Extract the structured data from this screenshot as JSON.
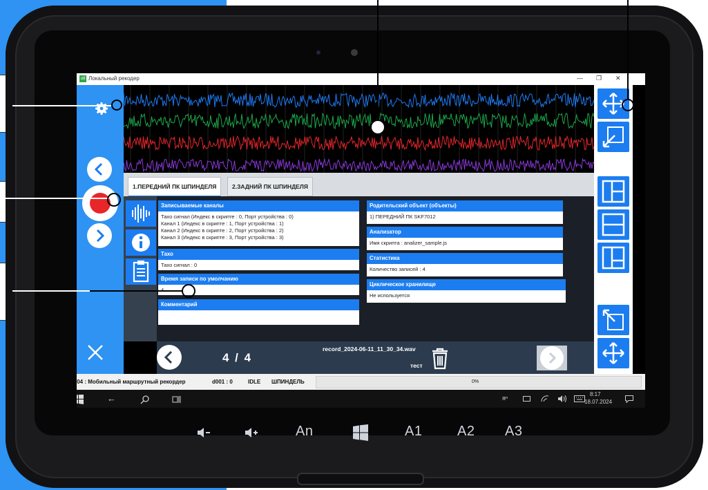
{
  "window": {
    "title": "Локальный рекодер",
    "logo_text": "u8",
    "controls": [
      "—",
      "❐",
      "✕"
    ]
  },
  "tabs": [
    {
      "label": "1.ПЕРЕДНИЙ ПК ШПИНДЕЛЯ",
      "active": true
    },
    {
      "label": "2.ЗАДНИЙ ПК ШПИНДЕЛЯ",
      "active": false
    }
  ],
  "waveform": {
    "channels": [
      {
        "color": "#1e7cf5"
      },
      {
        "color": "#1ea84a"
      },
      {
        "color": "#e8262a"
      },
      {
        "color": "#8a38d8"
      }
    ]
  },
  "cards_left": [
    {
      "header": "Записываемые каналы",
      "lines": [
        "Тахо сигнал (Индекс в скрипте : 0, Порт устройства : 0)",
        "Канал 1 (Индекс в скрипте : 1, Порт устройства : 1)",
        "Канал 2 (Индекс в скрипте : 2, Порт устройства : 2)",
        "Канал 3 (Индекс в скрипте : 3, Порт устройства : 3)"
      ]
    },
    {
      "header": "Тахо",
      "lines": [
        "Тахо сигнал : 0"
      ]
    },
    {
      "header": "Время записи по умолчанию",
      "lines": [
        "4"
      ]
    },
    {
      "header": "Комментарий",
      "lines": [
        ""
      ]
    }
  ],
  "cards_right": [
    {
      "header": "Родительский объект (объекты)",
      "lines": [
        "1) ПЕРЕДНИЙ ПК SKF7012"
      ]
    },
    {
      "header": "Анализатор",
      "lines": [
        "Имя скрипта : analizer_sample.js"
      ]
    },
    {
      "header": "Статистика",
      "lines": [
        "Количество записей : 4"
      ]
    },
    {
      "header": "Циклическое хранилище",
      "lines": [
        "Не используется"
      ]
    }
  ],
  "navigation": {
    "page": "4 / 4",
    "record_file": "record_2024-06-11_11_30_34.wav",
    "record_comment": "тест"
  },
  "status": {
    "device": "D104 : Мобильный маршрутный рекордер",
    "channel": "d001 : 0",
    "state": "IDLE",
    "mode": "ШПИНДЕЛЬ",
    "progress_label": "0%",
    "progress": 0
  },
  "taskbar": {
    "time": "8:17",
    "date": "18.07.2024"
  },
  "hardware_buttons": [
    "An",
    "A1",
    "A2",
    "A3"
  ],
  "colors": {
    "accent": "#1c7df0",
    "panel_blue": "#2e93f2",
    "record_red": "#e8262a"
  }
}
